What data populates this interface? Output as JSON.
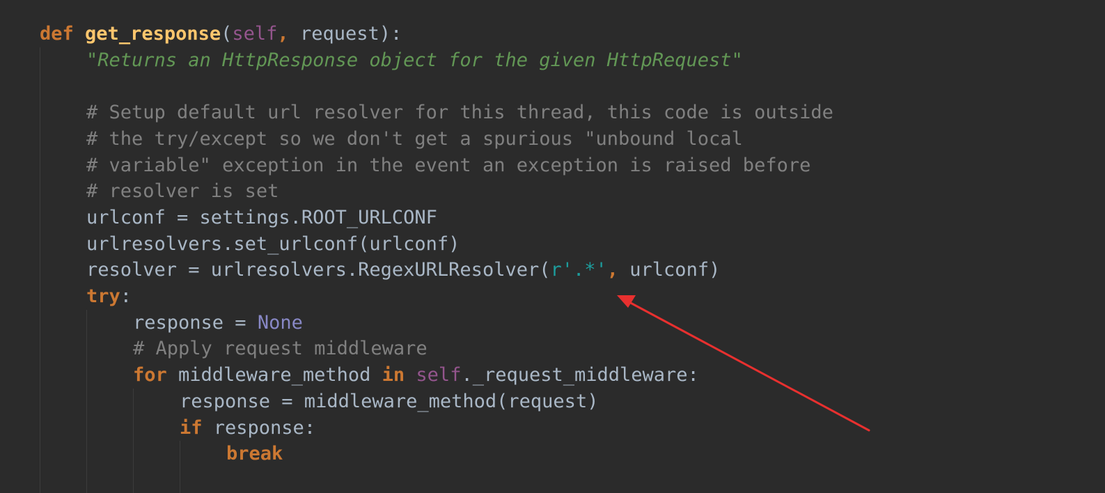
{
  "colors": {
    "background": "#2b2b2b",
    "default": "#a9b7c6",
    "keyword": "#cc7832",
    "function": "#ffc66d",
    "self": "#94558d",
    "docstring": "#629755",
    "comment": "#808080",
    "string": "#1d9c9c",
    "builtin_constant": "#8888c6",
    "annotation_arrow": "#e8302f"
  },
  "code": {
    "lines": [
      {
        "indent": 0,
        "tokens": [
          {
            "text": "def",
            "kind": "keyword"
          },
          {
            "text": " ",
            "kind": "default"
          },
          {
            "text": "get_response",
            "kind": "function"
          },
          {
            "text": "(",
            "kind": "default"
          },
          {
            "text": "self",
            "kind": "self"
          },
          {
            "text": ",",
            "kind": "keyword"
          },
          {
            "text": " request):",
            "kind": "default"
          }
        ]
      },
      {
        "indent": 1,
        "tokens": [
          {
            "text": "\"Returns an HttpResponse object for the given HttpRequest\"",
            "kind": "docstring"
          }
        ]
      },
      {
        "indent": 1,
        "tokens": []
      },
      {
        "indent": 1,
        "tokens": [
          {
            "text": "# Setup default url resolver for this thread, this code is outside",
            "kind": "comment"
          }
        ]
      },
      {
        "indent": 1,
        "tokens": [
          {
            "text": "# the try/except so we don't get a spurious \"unbound local",
            "kind": "comment"
          }
        ]
      },
      {
        "indent": 1,
        "tokens": [
          {
            "text": "# variable\" exception in the event an exception is raised before",
            "kind": "comment"
          }
        ]
      },
      {
        "indent": 1,
        "tokens": [
          {
            "text": "# resolver is set",
            "kind": "comment"
          }
        ]
      },
      {
        "indent": 1,
        "tokens": [
          {
            "text": "urlconf = settings.ROOT_URLCONF",
            "kind": "default"
          }
        ]
      },
      {
        "indent": 1,
        "tokens": [
          {
            "text": "urlresolvers.set_urlconf(urlconf)",
            "kind": "default"
          }
        ]
      },
      {
        "indent": 1,
        "tokens": [
          {
            "text": "resolver = urlresolvers.RegexURLResolver(",
            "kind": "default"
          },
          {
            "text": "r'.*'",
            "kind": "string"
          },
          {
            "text": ",",
            "kind": "keyword"
          },
          {
            "text": " urlconf)",
            "kind": "default"
          }
        ]
      },
      {
        "indent": 1,
        "tokens": [
          {
            "text": "try",
            "kind": "keyword"
          },
          {
            "text": ":",
            "kind": "default"
          }
        ]
      },
      {
        "indent": 2,
        "tokens": [
          {
            "text": "response = ",
            "kind": "default"
          },
          {
            "text": "None",
            "kind": "builtin_constant"
          }
        ]
      },
      {
        "indent": 2,
        "tokens": [
          {
            "text": "# Apply request middleware",
            "kind": "comment"
          }
        ]
      },
      {
        "indent": 2,
        "tokens": [
          {
            "text": "for",
            "kind": "keyword"
          },
          {
            "text": " middleware_method ",
            "kind": "default"
          },
          {
            "text": "in",
            "kind": "keyword"
          },
          {
            "text": " ",
            "kind": "default"
          },
          {
            "text": "self",
            "kind": "self"
          },
          {
            "text": "._request_middleware:",
            "kind": "default"
          }
        ]
      },
      {
        "indent": 3,
        "tokens": [
          {
            "text": "response = middleware_method(request)",
            "kind": "default"
          }
        ]
      },
      {
        "indent": 3,
        "tokens": [
          {
            "text": "if",
            "kind": "keyword"
          },
          {
            "text": " response:",
            "kind": "default"
          }
        ]
      },
      {
        "indent": 4,
        "tokens": [
          {
            "text": "break",
            "kind": "keyword"
          }
        ]
      }
    ]
  },
  "annotation": {
    "icon": "red-arrow-icon"
  }
}
